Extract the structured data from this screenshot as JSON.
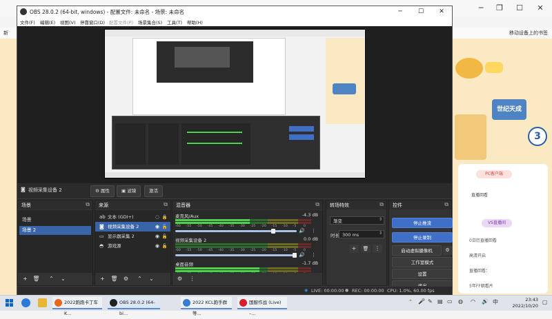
{
  "browser": {
    "bookmark_left": "新",
    "bookmark_folder": "移动设备上的书签",
    "banner_text": "世纪天成",
    "badge_number": "3",
    "right_btn1": "PC客户端",
    "right_btn2": "直播回看",
    "right_btn3": "VS直播间",
    "right_text1": "0日历直播回看",
    "right_text2": "高清开启",
    "right_text3": "直播回看：",
    "right_text4": "5年FF朝看片"
  },
  "obs": {
    "title": "OBS 28.0.2 (64-bit, windows) - 配置文件: 未命名 - 场景: 未命名",
    "window_controls": {
      "minimize": "─",
      "maximize": "☐",
      "close": "✕"
    },
    "menu": [
      "文件(F)",
      "编辑(E)",
      "视图(V)",
      "停靠窗口(D)",
      "配置文件(P)",
      "场景集合(S)",
      "工具(T)",
      "帮助(H)"
    ],
    "source_toolbar": {
      "current_source": "视频采集设备 2",
      "properties": "属性",
      "filters": "滤镜",
      "deactivate": "激活"
    },
    "scenes": {
      "title": "场景",
      "items": [
        "场景",
        "场景 2"
      ],
      "selected_index": 1
    },
    "sources": {
      "title": "来源",
      "items": [
        {
          "icon": "text-icon",
          "glyph": "ab",
          "label": "文本 (GDI+)"
        },
        {
          "icon": "camera-icon",
          "glyph": "◙",
          "label": "视频采集设备 2"
        },
        {
          "icon": "monitor-icon",
          "glyph": "▭",
          "label": "显示器采集 2"
        },
        {
          "icon": "game-icon",
          "glyph": "◓",
          "label": "游戏源"
        }
      ],
      "selected_index": 1
    },
    "mixer": {
      "title": "混音器",
      "scale_labels": [
        "-60",
        "-55",
        "-50",
        "-45",
        "-40",
        "-35",
        "-30",
        "-25",
        "-20",
        "-15",
        "-10",
        "-5",
        "0"
      ],
      "channels": [
        {
          "name": "麦克风/Aux",
          "db": "-4.3 dB",
          "level": 0.55,
          "volume": 0.82
        },
        {
          "name": "视频采集设备 2",
          "db": "0.0 dB",
          "level": 0.0,
          "volume": 1.0
        },
        {
          "name": "桌面音频",
          "db": "-1.7 dB",
          "level": 0.62,
          "volume": 0.95
        }
      ]
    },
    "transitions": {
      "title": "转场特效",
      "type": "渐变",
      "duration_label": "时长",
      "duration_value": "300 ms"
    },
    "controls": {
      "title": "控件",
      "buttons": [
        {
          "label": "停止推流",
          "active": true
        },
        {
          "label": "停止录制",
          "active": true
        },
        {
          "label": "启动虚拟摄像机",
          "active": false
        },
        {
          "label": "工作室模式",
          "active": false
        },
        {
          "label": "设置",
          "active": false
        },
        {
          "label": "退出",
          "active": false
        }
      ]
    },
    "status": {
      "live": "LIVE: 00:00:00",
      "rec": "REC: 00:00:00",
      "cpu": "CPU: 1.0%, 60.00 fps"
    }
  },
  "taskbar": {
    "apps": [
      {
        "label": "2022跑跑卡丁车K...",
        "color": "#e8681f"
      },
      {
        "label": "OBS 28.0.2 (64-bi...",
        "color": "#222222"
      },
      {
        "label": "2022 KCL跑手群等...",
        "color": "#3a7bd5"
      },
      {
        "label": "国服作战 (Live) –...",
        "color": "#d81e2a"
      }
    ],
    "time": "23:43",
    "date": "2022/10/20"
  },
  "colors": {
    "accent_blue": "#3f6fc6",
    "selection": "#3964a8",
    "obs_bg": "#2b2b2b"
  }
}
